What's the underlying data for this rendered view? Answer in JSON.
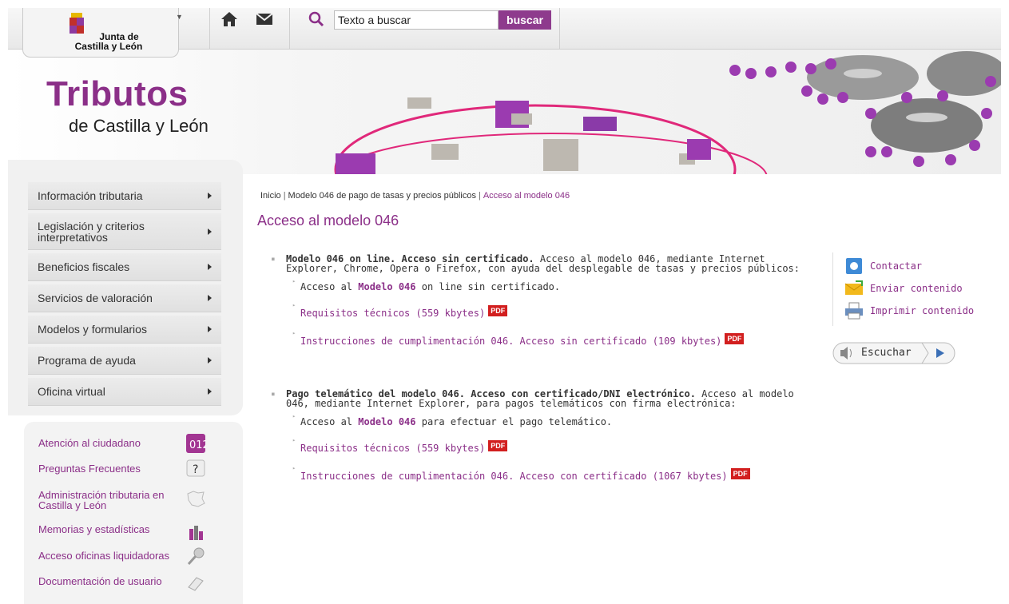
{
  "header": {
    "logo_line1": "Junta de",
    "logo_line2": "Castilla y León",
    "search_placeholder": "Texto a buscar",
    "search_button": "buscar"
  },
  "banner": {
    "title": "Tributos",
    "subtitle": "de Castilla y León"
  },
  "nav": {
    "items": [
      "Información tributaria",
      "Legislación y criterios interpretativos",
      "Beneficios fiscales",
      "Servicios de valoración",
      "Modelos y formularios",
      "Programa de ayuda",
      "Oficina virtual"
    ]
  },
  "links": {
    "items": [
      "Atención al ciudadano",
      "Preguntas Frecuentes",
      "Administración tributaria en Castilla y León",
      "Memorias y estadísticas",
      "Acceso oficinas liquidadoras",
      "Documentación de usuario"
    ]
  },
  "breadcrumb": {
    "home": "Inicio",
    "parent": "Modelo 046 de pago de tasas y precios públicos",
    "current": "Acceso al modelo 046"
  },
  "main": {
    "title": "Acceso al modelo 046",
    "section1": {
      "head_bold": "Modelo 046 on line. Acceso sin certificado.",
      "head_text": " Acceso al modelo 046, mediante Internet Explorer, Chrome, Opera o Firefox, con ayuda del desplegable de tasas y precios públicos:",
      "access_prefix": "Acceso al ",
      "access_link": "Modelo 046",
      "access_suffix": " on line sin certificado.",
      "req_link": "Requisitos técnicos (559 kbytes)",
      "instr_link": "Instrucciones de cumplimentación 046. Acceso sin certificado (109 kbytes)"
    },
    "section2": {
      "head_bold": "Pago telemático del modelo 046. Acceso con certificado/DNI electrónico.",
      "head_text": " Acceso al modelo 046, mediante Internet Explorer, para pagos telemáticos con firma electrónica:",
      "access_prefix": "Acceso al ",
      "access_link": "Modelo 046",
      "access_suffix": " para efectuar el pago telemático.",
      "req_link": "Requisitos técnicos (559 kbytes)",
      "instr_link": "Instrucciones de cumplimentación 046. Acceso con certificado (1067 kbytes)"
    },
    "pdf_label": "PDF"
  },
  "tools": {
    "contact": "Contactar",
    "send": "Enviar contenido",
    "print": "Imprimir contenido",
    "listen": "Escuchar"
  },
  "colors": {
    "accent": "#8b2f88",
    "pdf": "#d21f1f"
  }
}
